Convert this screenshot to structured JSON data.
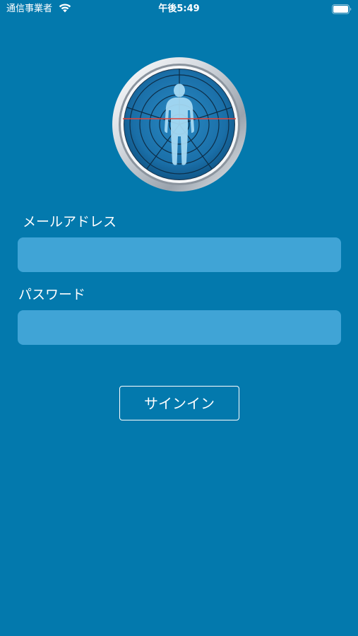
{
  "status_bar": {
    "carrier": "通信事業者",
    "time": "午後5:49",
    "wifi_icon": "wifi-icon",
    "battery_icon": "battery-icon",
    "battery_level": 1.0
  },
  "logo": {
    "icon": "body-radar-icon",
    "ring_color": "#d8dde3",
    "dish_color": "#1a6fa8",
    "scan_line_color": "#e1443a",
    "figure_color": "#a9dcf5"
  },
  "login_form": {
    "email_label": "メールアドレス",
    "email_value": "",
    "password_label": "パスワード",
    "password_value": "",
    "signin_label": "サインイン"
  },
  "colors": {
    "background": "#0379ad",
    "field_background": "#40a4d6",
    "text": "#ffffff"
  }
}
